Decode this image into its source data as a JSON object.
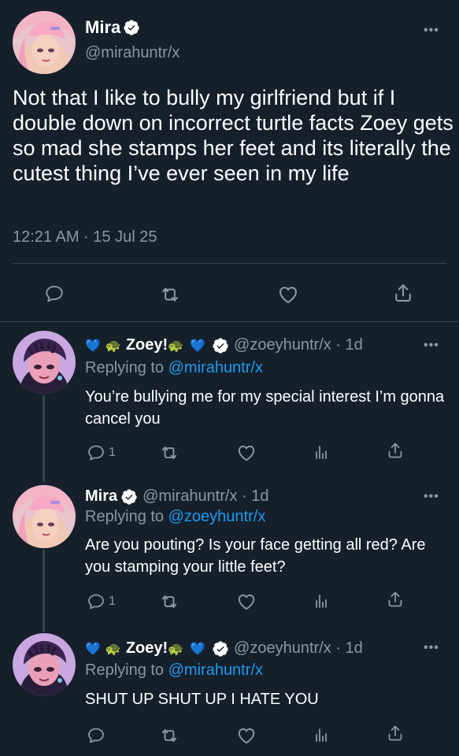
{
  "main_tweet": {
    "name": "Mira",
    "handle": "@mirahuntr/x",
    "text": "Not that I like to bully my girlfriend but if I double down on incorrect turtle facts Zoey gets so mad she stamps her feet and its literally the cutest thing I’ve ever seen in my life",
    "time": "12:21 AM · 15 Jul 25",
    "more_icon": "•••"
  },
  "replies": [
    {
      "name_prefix": "💙",
      "turtle1": "🐢",
      "name": "Zoey!",
      "turtle2": "🐢",
      "heart": "💙",
      "handle_time": "@zoeyhuntr/x · 1d",
      "replying_label": "Replying to ",
      "replying_to": "@mirahuntr/x",
      "text": "You’re bullying me for my special interest I’m gonna cancel you",
      "reply_count": "1",
      "more_icon": "•••"
    },
    {
      "name": "Mira",
      "handle_time": "@mirahuntr/x · 1d",
      "replying_label": "Replying to ",
      "replying_to": "@zoeyhuntr/x",
      "text": "Are you pouting? Is your face getting all red? Are you stamping your little feet?",
      "reply_count": "1",
      "more_icon": "•••"
    },
    {
      "name_prefix": "💙",
      "turtle1": "🐢",
      "name": "Zoey!",
      "turtle2": "🐢",
      "heart": "💙",
      "handle_time": "@zoeyhuntr/x · 1d",
      "replying_label": "Replying to ",
      "replying_to": "@mirahuntr/x",
      "text": "SHUT UP SHUT UP I HATE YOU",
      "reply_count": "",
      "more_icon": "•••"
    }
  ],
  "icons": {
    "reply": "reply-icon",
    "retweet": "retweet-icon",
    "like": "heart-icon",
    "share": "share-icon",
    "analytics": "analytics-icon",
    "verified": "verified-badge-icon"
  },
  "colors": {
    "background": "#15202b",
    "text": "#ffffff",
    "secondary": "#8899a6",
    "link": "#1d9bf0",
    "divider": "#38444d"
  }
}
